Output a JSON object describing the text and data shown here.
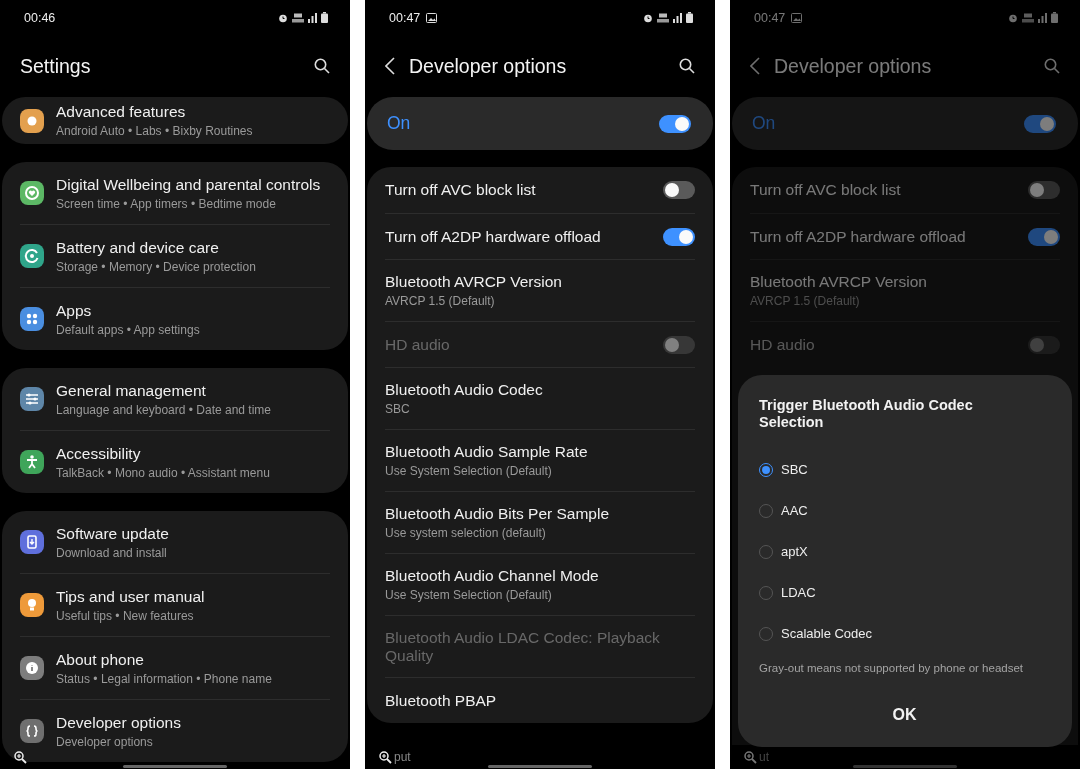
{
  "screens": [
    {
      "kind": "settings",
      "status_bar": {
        "time": "00:46"
      },
      "title": "Settings",
      "groups": [
        {
          "items": [
            {
              "title": "Advanced features",
              "subtitle": "Android Auto • Labs • Bixby Routines",
              "color": "#e3a04e"
            }
          ]
        },
        {
          "items": [
            {
              "title": "Digital Wellbeing and parental controls",
              "subtitle": "Screen time • App timers • Bedtime mode",
              "color": "#5cb865"
            },
            {
              "title": "Battery and device care",
              "subtitle": "Storage • Memory • Device protection",
              "color": "#2fa58a"
            },
            {
              "title": "Apps",
              "subtitle": "Default apps • App settings",
              "color": "#4a8ee0"
            }
          ]
        },
        {
          "items": [
            {
              "title": "General management",
              "subtitle": "Language and keyboard • Date and time",
              "color": "#5e86a8"
            },
            {
              "title": "Accessibility",
              "subtitle": "TalkBack • Mono audio • Assistant menu",
              "color": "#3fa55a"
            }
          ]
        },
        {
          "items": [
            {
              "title": "Software update",
              "subtitle": "Download and install",
              "color": "#5f6fdc"
            },
            {
              "title": "Tips and user manual",
              "subtitle": "Useful tips • New features",
              "color": "#ee9a3a"
            },
            {
              "title": "About phone",
              "subtitle": "Status • Legal information • Phone name",
              "color": "#7d7d7d"
            },
            {
              "title": "Developer options",
              "subtitle": "Developer options",
              "color": "#6f6f6f"
            }
          ]
        }
      ]
    },
    {
      "kind": "developer",
      "status_bar": {
        "time": "00:47",
        "image_notification": true
      },
      "title": "Developer options",
      "master": {
        "label": "On",
        "on": true
      },
      "rows": [
        {
          "kind": "switch",
          "title": "Turn off AVC block list",
          "on": false,
          "disabled": false
        },
        {
          "kind": "switch",
          "title": "Turn off A2DP hardware offload",
          "on": true,
          "disabled": false
        },
        {
          "kind": "item",
          "title": "Bluetooth AVRCP Version",
          "subtitle": "AVRCP 1.5 (Default)",
          "disabled": false
        },
        {
          "kind": "switch",
          "title": "HD audio",
          "on": false,
          "disabled": true
        },
        {
          "kind": "item",
          "title": "Bluetooth Audio Codec",
          "subtitle": "SBC",
          "disabled": false
        },
        {
          "kind": "item",
          "title": "Bluetooth Audio Sample Rate",
          "subtitle": "Use System Selection (Default)",
          "disabled": false
        },
        {
          "kind": "item",
          "title": "Bluetooth Audio Bits Per Sample",
          "subtitle": "Use system selection (default)",
          "disabled": false
        },
        {
          "kind": "item",
          "title": "Bluetooth Audio Channel Mode",
          "subtitle": "Use System Selection (Default)",
          "disabled": false
        },
        {
          "kind": "item",
          "title": "Bluetooth Audio LDAC Codec: Playback Quality",
          "disabled": true
        },
        {
          "kind": "item",
          "title": "Bluetooth PBAP",
          "disabled": false
        }
      ],
      "bottom_text": "put"
    },
    {
      "kind": "developer",
      "status_bar": {
        "time": "00:47",
        "image_notification": true
      },
      "title": "Developer options",
      "master": {
        "label": "On",
        "on": true
      },
      "rows": [
        {
          "kind": "switch",
          "title": "Turn off AVC block list",
          "on": false,
          "disabled": false
        },
        {
          "kind": "switch",
          "title": "Turn off A2DP hardware offload",
          "on": true,
          "disabled": false
        },
        {
          "kind": "item",
          "title": "Bluetooth AVRCP Version",
          "subtitle": "AVRCP 1.5 (Default)",
          "disabled": false
        },
        {
          "kind": "switch",
          "title": "HD audio",
          "on": false,
          "disabled": true
        }
      ],
      "bottom_text": "ut",
      "dialog": {
        "title": "Trigger Bluetooth Audio Codec Selection",
        "options": [
          {
            "label": "SBC",
            "selected": true
          },
          {
            "label": "AAC",
            "selected": false
          },
          {
            "label": "aptX",
            "selected": false
          },
          {
            "label": "LDAC",
            "selected": false
          },
          {
            "label": "Scalable Codec",
            "selected": false
          }
        ],
        "note": "Gray-out means not supported by phone or headset",
        "button": "OK"
      }
    }
  ]
}
